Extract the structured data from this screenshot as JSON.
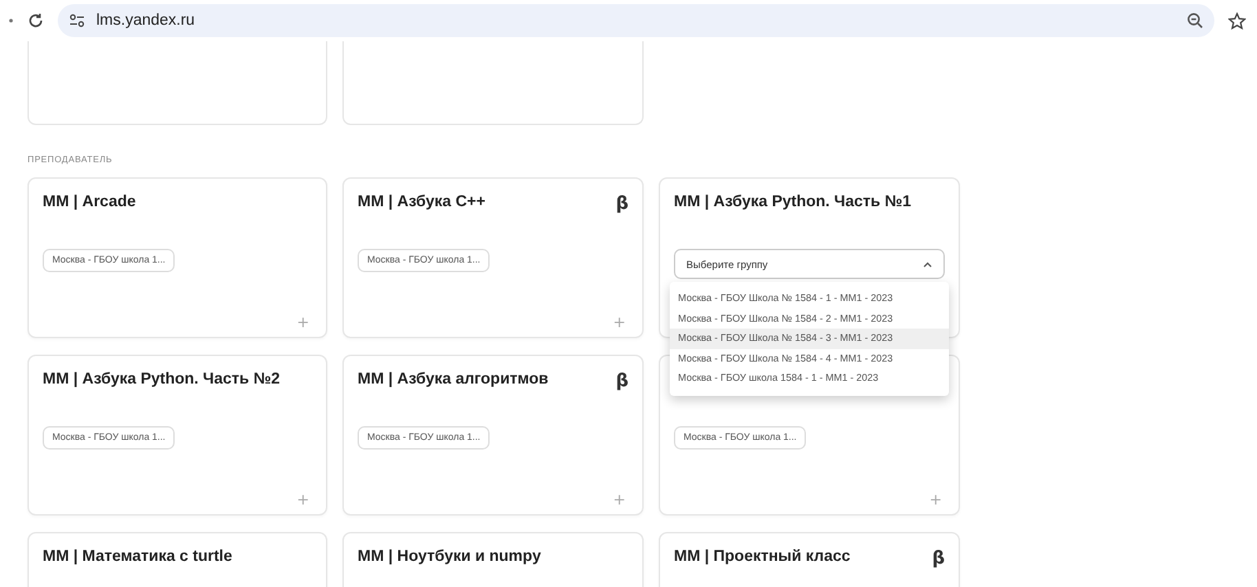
{
  "browser": {
    "url": "lms.yandex.ru"
  },
  "section_label": "ПРЕПОДАВАТЕЛЬ",
  "courses": [
    {
      "title": "ММ | Arcade",
      "group_chip": "Москва - ГБОУ школа 1...",
      "add": "+"
    },
    {
      "title": "ММ | Азбука С++",
      "beta_mark": "β",
      "group_chip": "Москва - ГБОУ школа 1...",
      "add": "+"
    },
    {
      "title": "ММ | Азбука Python. Часть №1",
      "group_select": {
        "placeholder": "Выберите группу",
        "expanded": true,
        "options": [
          {
            "label": "Москва - ГБОУ Школа № 1584 - 1 - ММ1 - 2023",
            "highlighted": false
          },
          {
            "label": "Москва - ГБОУ Школа № 1584 - 2 - ММ1 - 2023",
            "highlighted": false
          },
          {
            "label": "Москва - ГБОУ Школа № 1584 - 3 - ММ1 - 2023",
            "highlighted": true
          },
          {
            "label": "Москва - ГБОУ Школа № 1584 - 4 - ММ1 - 2023",
            "highlighted": false
          },
          {
            "label": "Москва - ГБОУ школа 1584 - 1 - ММ1 - 2023",
            "highlighted": false
          }
        ]
      }
    },
    {
      "title": "ММ | Азбука Python. Часть №2",
      "group_chip": "Москва - ГБОУ школа 1...",
      "add": "+"
    },
    {
      "title": "ММ | Азбука алгоритмов",
      "beta_mark": "β",
      "group_chip": "Москва - ГБОУ школа 1...",
      "add": "+"
    },
    {
      "group_chip": "Москва - ГБОУ школа 1...",
      "add": "+"
    },
    {
      "title": "ММ | Математика с turtle"
    },
    {
      "title": "ММ | Ноутбуки и numpy"
    },
    {
      "title": "ММ | Проектный класс",
      "beta_mark": "β"
    }
  ]
}
